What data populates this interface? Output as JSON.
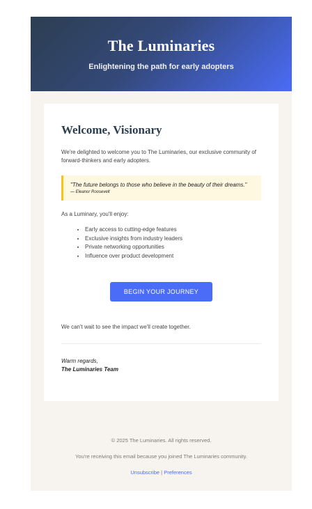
{
  "header": {
    "brand": "The Luminaries",
    "tagline": "Enlightening the path for early adopters"
  },
  "card": {
    "welcome_title": "Welcome, Visionary",
    "intro": "We're delighted to welcome you to The Luminaries, our exclusive community of forward-thinkers and early adopters.",
    "quote": {
      "text": "\"The future belongs to those who believe in the beauty of their dreams.\"",
      "author": "— Eleanor Roosevelt"
    },
    "benefits_intro": "As a Luminary, you'll enjoy:",
    "benefits": [
      "Early access to cutting-edge features",
      "Exclusive insights from industry leaders",
      "Private networking opportunities",
      "Influence over product development"
    ],
    "cta_label": "BEGIN YOUR JOURNEY",
    "closing": "We can't wait to see the impact we'll create together.",
    "signoff": "Warm regards,",
    "team": "The Luminaries Team"
  },
  "footer": {
    "copyright": "© 2025 The Luminaries. All rights reserved.",
    "notice": "You're receiving this email because you joined The Luminaries community.",
    "unsubscribe": "Unsubscribe",
    "separator": "|",
    "preferences": "Preferences"
  },
  "colors": {
    "header_gradient_start": "#2c3e50",
    "header_gradient_end": "#4a6cf7",
    "accent": "#4a6cf7",
    "quote_border": "#f5c518",
    "quote_background": "#fff8e1",
    "background": "#f7f4ef"
  }
}
